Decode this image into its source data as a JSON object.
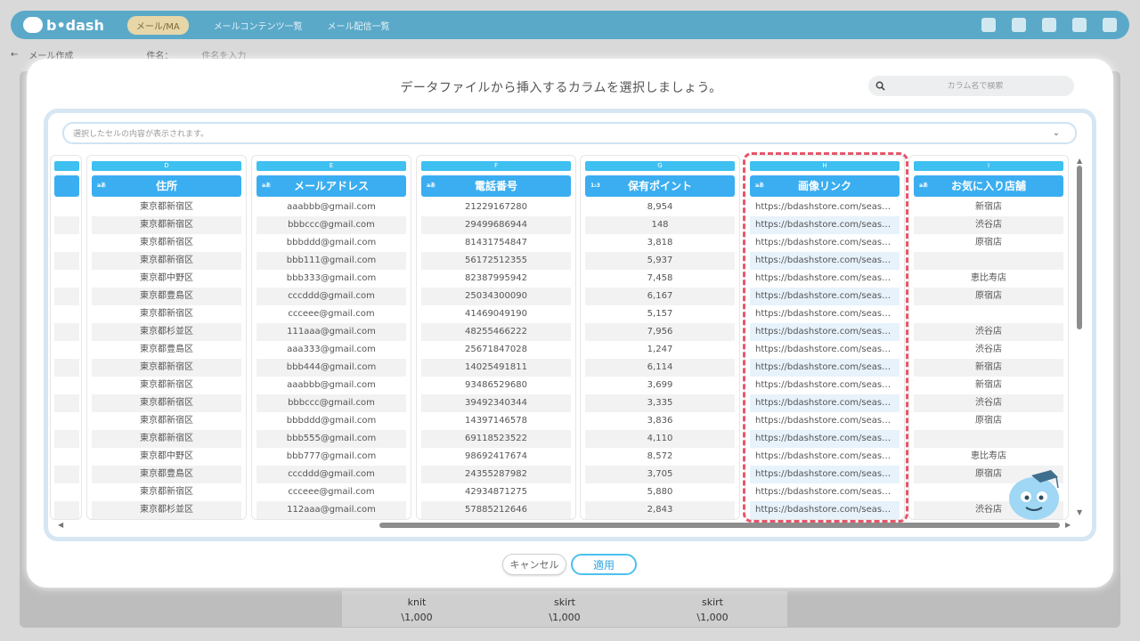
{
  "app": {
    "logo": "b•dash",
    "app_menu": "メール/MA",
    "nav": [
      "メールコンテンツ一覧",
      "メール配信一覧"
    ],
    "breadcrumb": "メール作成",
    "subject_label": "件名：",
    "subject_placeholder": "件名を入力"
  },
  "background_cells": [
    {
      "name": "knit",
      "price": "\\1,000"
    },
    {
      "name": "skirt",
      "price": "\\1,000"
    },
    {
      "name": "skirt",
      "price": "\\1,000"
    }
  ],
  "modal": {
    "title": "データファイルから挿入するカラムを選択しましょう。",
    "search_placeholder": "カラム名で検索",
    "cell_preview_placeholder": "選択したセルの内容が表示されます。",
    "cancel_label": "キャンセル",
    "apply_label": "適用"
  },
  "columns": [
    {
      "letter": "D",
      "type": "aあ",
      "header": "住所",
      "rows": [
        "東京都新宿区",
        "東京都新宿区",
        "東京都新宿区",
        "東京都新宿区",
        "東京都中野区",
        "東京都豊島区",
        "東京都新宿区",
        "東京都杉並区",
        "東京都豊島区",
        "東京都新宿区",
        "東京都新宿区",
        "東京都新宿区",
        "東京都新宿区",
        "東京都新宿区",
        "東京都中野区",
        "東京都豊島区",
        "東京都新宿区",
        "東京都杉並区"
      ]
    },
    {
      "letter": "E",
      "type": "aあ",
      "header": "メールアドレス",
      "rows": [
        "aaabbb@gmail.com",
        "bbbccc@gmail.com",
        "bbbddd@gmail.com",
        "bbb111@gmail.com",
        "bbb333@gmail.com",
        "cccddd@gmail.com",
        "ccceee@gmail.com",
        "111aaa@gmail.com",
        "aaa333@gmail.com",
        "bbb444@gmail.com",
        "aaabbb@gmail.com",
        "bbbccc@gmail.com",
        "bbbddd@gmail.com",
        "bbb555@gmail.com",
        "bbb777@gmail.com",
        "cccddd@gmail.com",
        "ccceee@gmail.com",
        "112aaa@gmail.com"
      ]
    },
    {
      "letter": "F",
      "type": "aあ",
      "header": "電話番号",
      "rows": [
        "21229167280",
        "29499686944",
        "81431754847",
        "56172512355",
        "82387995942",
        "25034300090",
        "41469049190",
        "48255466222",
        "25671847028",
        "14025491811",
        "93486529680",
        "39492340344",
        "14397146578",
        "69118523522",
        "98692417674",
        "24355287982",
        "42934871275",
        "57885212646"
      ]
    },
    {
      "letter": "G",
      "type": "1₂3",
      "header": "保有ポイント",
      "rows": [
        "8,954",
        "148",
        "3,818",
        "5,937",
        "7,458",
        "6,167",
        "5,157",
        "7,956",
        "1,247",
        "6,114",
        "3,699",
        "3,335",
        "3,836",
        "4,110",
        "8,572",
        "3,705",
        "5,880",
        "2,843"
      ]
    },
    {
      "letter": "H",
      "type": "aあ",
      "header": "画像リンク",
      "rows": [
        "https://bdashstore.com/seaso...",
        "https://bdashstore.com/seaso...",
        "https://bdashstore.com/seaso...",
        "https://bdashstore.com/seaso...",
        "https://bdashstore.com/seaso...",
        "https://bdashstore.com/seaso...",
        "https://bdashstore.com/seaso...",
        "https://bdashstore.com/seaso...",
        "https://bdashstore.com/seaso...",
        "https://bdashstore.com/seaso...",
        "https://bdashstore.com/seaso...",
        "https://bdashstore.com/seaso...",
        "https://bdashstore.com/seaso...",
        "https://bdashstore.com/seaso...",
        "https://bdashstore.com/seaso...",
        "https://bdashstore.com/seaso...",
        "https://bdashstore.com/seaso...",
        "https://bdashstore.com/seaso..."
      ]
    },
    {
      "letter": "I",
      "type": "aあ",
      "header": "お気に入り店舗",
      "rows": [
        "新宿店",
        "渋谷店",
        "原宿店",
        "",
        "恵比寿店",
        "原宿店",
        "",
        "渋谷店",
        "渋谷店",
        "新宿店",
        "新宿店",
        "渋谷店",
        "原宿店",
        "",
        "恵比寿店",
        "原宿店",
        "",
        "渋谷店"
      ]
    }
  ],
  "selected_column": "H",
  "accent_color": "#3aaef0",
  "highlight_color": "#e8556b"
}
